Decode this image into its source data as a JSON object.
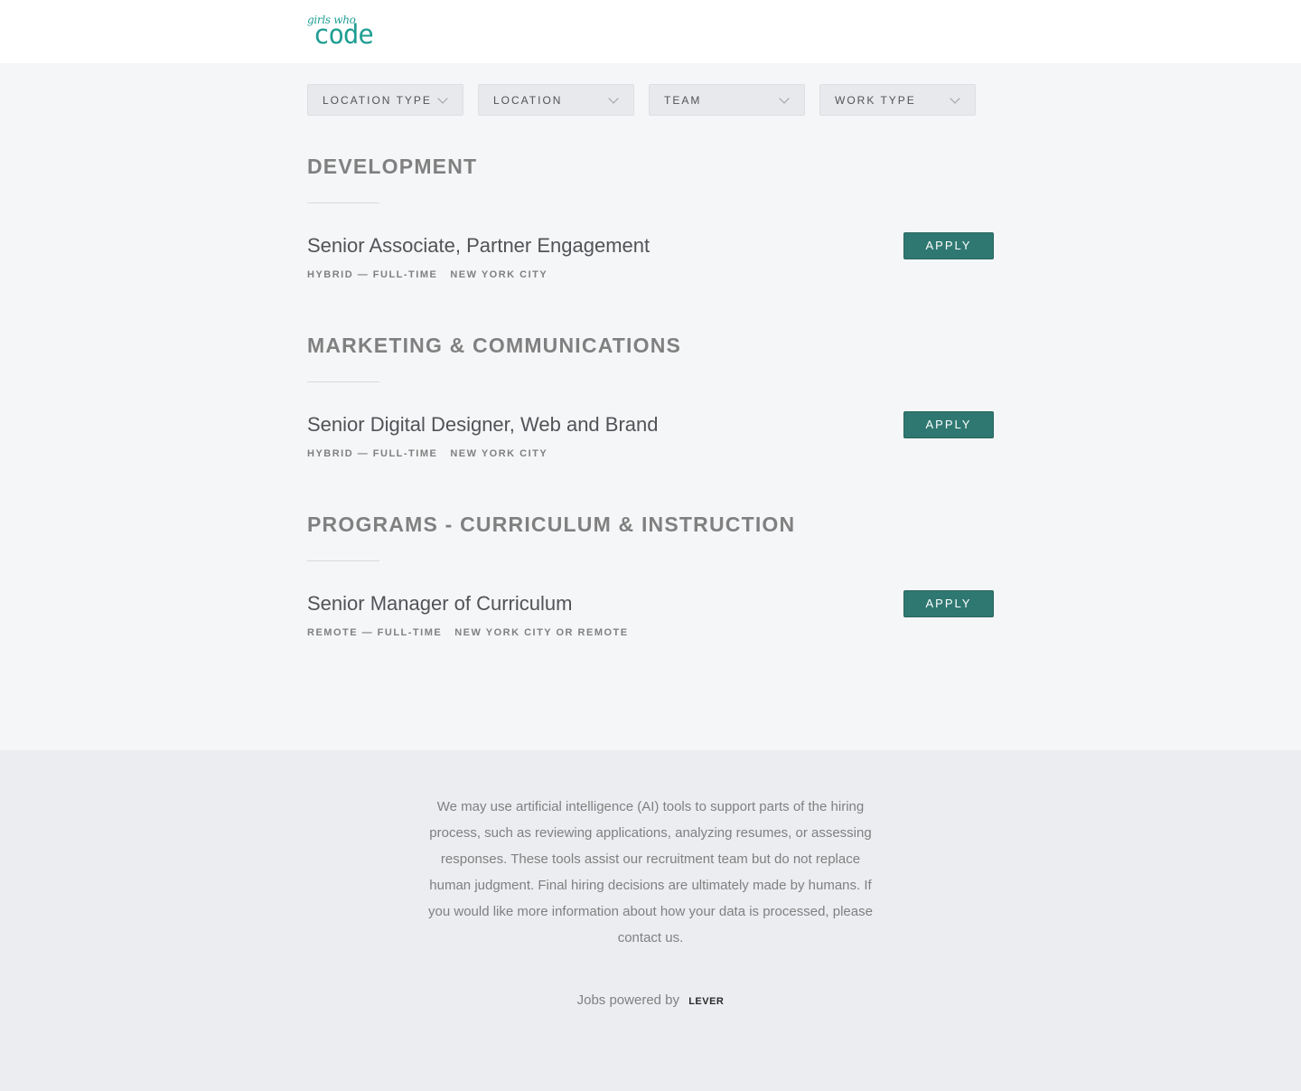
{
  "header": {
    "logo_script": "girls who",
    "logo_block": "code"
  },
  "filters": [
    {
      "label": "LOCATION TYPE"
    },
    {
      "label": "LOCATION"
    },
    {
      "label": "TEAM"
    },
    {
      "label": "WORK TYPE"
    }
  ],
  "sections": [
    {
      "title": "DEVELOPMENT",
      "postings": [
        {
          "title": "Senior Associate, Partner Engagement",
          "work_type": "HYBRID — FULL-TIME",
          "location": "NEW YORK CITY",
          "apply_label": "APPLY"
        }
      ]
    },
    {
      "title": "MARKETING & COMMUNICATIONS",
      "postings": [
        {
          "title": "Senior Digital Designer, Web and Brand",
          "work_type": "HYBRID — FULL-TIME",
          "location": "NEW YORK CITY",
          "apply_label": "APPLY"
        }
      ]
    },
    {
      "title": "PROGRAMS - CURRICULUM & INSTRUCTION",
      "postings": [
        {
          "title": "Senior Manager of Curriculum",
          "work_type": "REMOTE — FULL-TIME",
          "location": "NEW YORK CITY OR REMOTE",
          "apply_label": "APPLY"
        }
      ]
    }
  ],
  "footer": {
    "disclaimer": "We may use artificial intelligence (AI) tools to support parts of the hiring process, such as reviewing applications, analyzing resumes, or assessing responses. These tools assist our recruitment team but do not replace human judgment. Final hiring decisions are ultimately made by humans. If you would like more information about how your data is processed, please contact us.",
    "powered_text": "Jobs powered by",
    "lever_label": "LEVER"
  },
  "colors": {
    "brand_teal": "#1f9e93",
    "apply_button": "#2f7872",
    "page_bg": "#f5f6f7",
    "footer_bg": "#ebedf0"
  }
}
